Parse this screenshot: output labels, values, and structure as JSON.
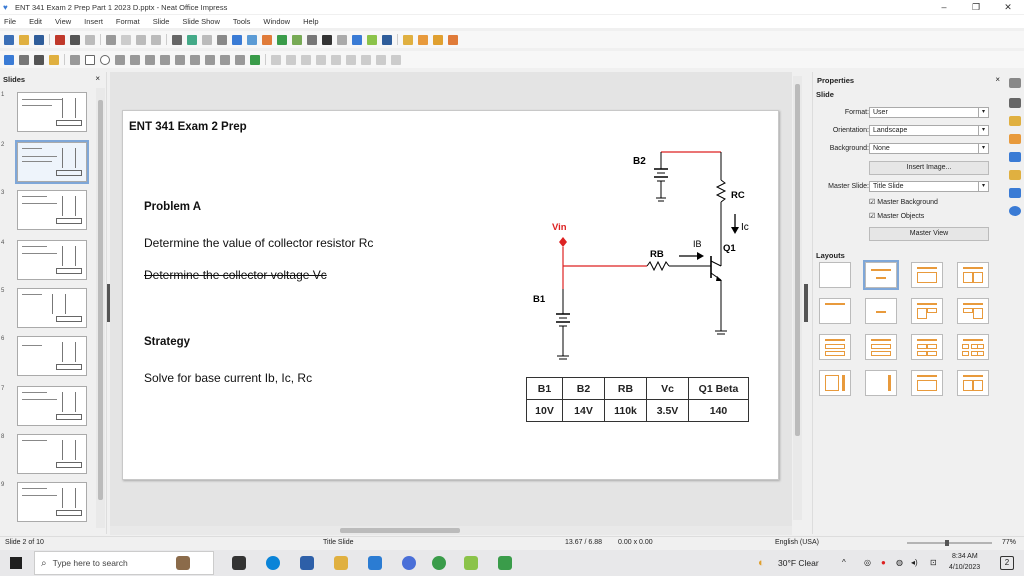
{
  "window": {
    "title": "ENT 341 Exam 2 Prep Part 1 2023 D.pptx - Neat Office Impress",
    "buttons": [
      "–",
      "❐",
      "✕"
    ]
  },
  "menu": [
    "File",
    "Edit",
    "View",
    "Insert",
    "Format",
    "Slide",
    "Slide Show",
    "Tools",
    "Window",
    "Help"
  ],
  "slides_pane": {
    "header": "Slides",
    "close": "×",
    "numbers": [
      "1",
      "2",
      "3",
      "4",
      "5",
      "6",
      "7",
      "8",
      "9"
    ]
  },
  "slide": {
    "title": "ENT 341 Exam 2 Prep",
    "problem_heading": "Problem A",
    "line1": "Determine the value of collector resistor Rc",
    "line2": "Determine the collector voltage Vc",
    "strategy_heading": "Strategy",
    "strategy_text": "Solve for base current Ib, Ic, Rc",
    "circuit": {
      "b2": "B2",
      "rc": "RC",
      "ic": "Ic",
      "vin": "Vin",
      "rb": "RB",
      "ib": "IB",
      "q1": "Q1",
      "b1": "B1"
    },
    "table": {
      "headers": [
        "B1",
        "B2",
        "RB",
        "Vc",
        "Q1 Beta"
      ],
      "values": [
        "10V",
        "14V",
        "110k",
        "3.5V",
        "140"
      ]
    }
  },
  "properties": {
    "title": "Properties",
    "close": "×",
    "section_slide": "Slide",
    "format_label": "Format:",
    "format_value": "User",
    "orientation_label": "Orientation:",
    "orientation_value": "Landscape",
    "background_label": "Background:",
    "background_value": "None",
    "insert_image": "Insert Image...",
    "master_slide_label": "Master Slide:",
    "master_slide_value": "Title Slide",
    "master_background": "Master Background",
    "master_objects": "Master Objects",
    "master_view": "Master View",
    "section_layouts": "Layouts"
  },
  "status": {
    "slide_of": "Slide 2 of 10",
    "master": "Title Slide",
    "position": "13.67 / 6.88",
    "size": "0.00 x 0.00",
    "language": "English (USA)",
    "zoom": "77%"
  },
  "taskbar": {
    "search_placeholder": "Type here to search",
    "weather": "30°F Clear",
    "time": "8:34 AM",
    "date": "4/10/2023",
    "notifications": "2"
  }
}
